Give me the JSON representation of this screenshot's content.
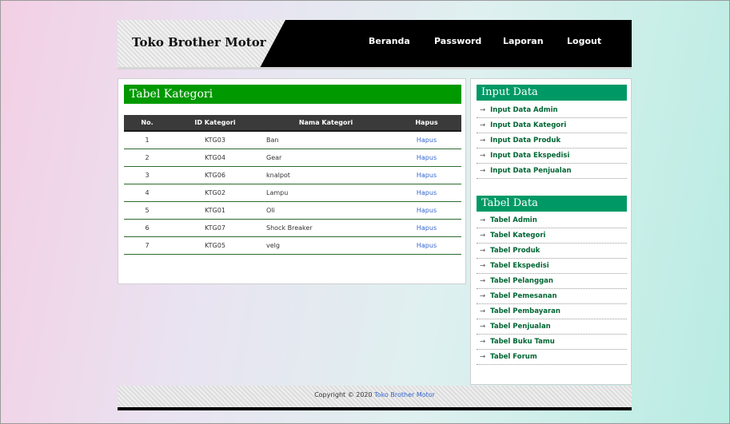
{
  "header": {
    "title": "Toko Brother Motor",
    "nav": [
      "Beranda",
      "Password",
      "Laporan",
      "Logout"
    ]
  },
  "main": {
    "heading": "Tabel Kategori",
    "columns": [
      "No.",
      "ID Kategori",
      "Nama Kategori",
      "Hapus"
    ],
    "rows": [
      {
        "no": "1",
        "id": "KTG03",
        "nama": "Ban",
        "hapus": "Hapus"
      },
      {
        "no": "2",
        "id": "KTG04",
        "nama": "Gear",
        "hapus": "Hapus"
      },
      {
        "no": "3",
        "id": "KTG06",
        "nama": "knalpot",
        "hapus": "Hapus"
      },
      {
        "no": "4",
        "id": "KTG02",
        "nama": "Lampu",
        "hapus": "Hapus"
      },
      {
        "no": "5",
        "id": "KTG01",
        "nama": "Oli",
        "hapus": "Hapus"
      },
      {
        "no": "6",
        "id": "KTG07",
        "nama": "Shock Breaker",
        "hapus": "Hapus"
      },
      {
        "no": "7",
        "id": "KTG05",
        "nama": "velg",
        "hapus": "Hapus"
      }
    ]
  },
  "sidebar": {
    "input_heading": "Input Data",
    "input_items": [
      "Input Data Admin",
      "Input Data Kategori",
      "Input Data Produk",
      "Input Data Ekspedisi",
      "Input Data Penjualan"
    ],
    "tabel_heading": "Tabel Data",
    "tabel_items": [
      "Tabel Admin",
      "Tabel Kategori",
      "Tabel Produk",
      "Tabel Ekspedisi",
      "Tabel Pelanggan",
      "Tabel Pemesanan",
      "Tabel Pembayaran",
      "Tabel Penjualan",
      "Tabel Buku Tamu",
      "Tabel Forum"
    ]
  },
  "footer": {
    "prefix": "Copyright © 2020",
    "link": "Toko Brother Motor"
  },
  "colors": {
    "heading_green": "#009900",
    "sidebar_heading": "#009966",
    "link_blue": "#3366cc"
  }
}
